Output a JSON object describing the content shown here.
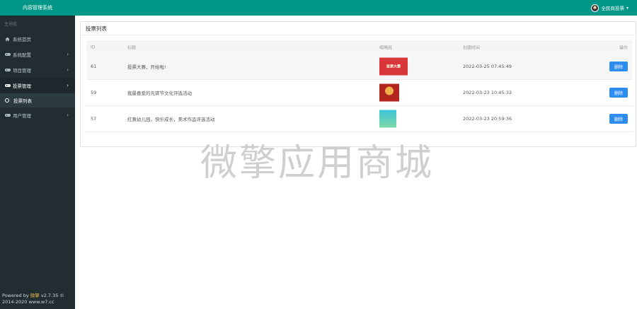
{
  "sidebar": {
    "brand": "内容管理系统",
    "section_label": "主导航",
    "items": [
      {
        "label": "系统首页",
        "icon": "home-icon"
      },
      {
        "label": "系统配置",
        "icon": "gamepad-icon"
      },
      {
        "label": "项目管理",
        "icon": "gamepad-icon"
      },
      {
        "label": "投票管理",
        "icon": "gamepad-icon"
      },
      {
        "label": "用户管理",
        "icon": "gamepad-icon"
      }
    ],
    "active_sub": "投票列表",
    "footer_prefix": "Powered by",
    "footer_brand": "微擎",
    "footer_version": "v2.7.35 ©",
    "footer_line2": "2014-2020 www.w7.cc"
  },
  "header": {
    "user_name": "全民商投票"
  },
  "panel": {
    "title": "投票列表",
    "columns": [
      "ID",
      "标题",
      "缩略图",
      "创建时间",
      "操作"
    ],
    "rows": [
      {
        "id": "61",
        "title": "投票大赛，开始啦!",
        "thumb_text": "投票大赛",
        "created": "2022-03-25 07:45:49",
        "action": "删除"
      },
      {
        "id": "59",
        "title": "我最喜爱的元宵节文化评选活动",
        "thumb_text": "",
        "created": "2022-03-23 10:45:33",
        "action": "删除"
      },
      {
        "id": "57",
        "title": "红黄幼儿园，快乐成长，美术作品评选活动",
        "thumb_text": "",
        "created": "2022-03-23 20:59:36",
        "action": "删除"
      }
    ]
  },
  "watermark": "微擎应用商城",
  "colors": {
    "accent": "#009688",
    "sidebar": "#222d32",
    "button": "#2d8cf0"
  }
}
